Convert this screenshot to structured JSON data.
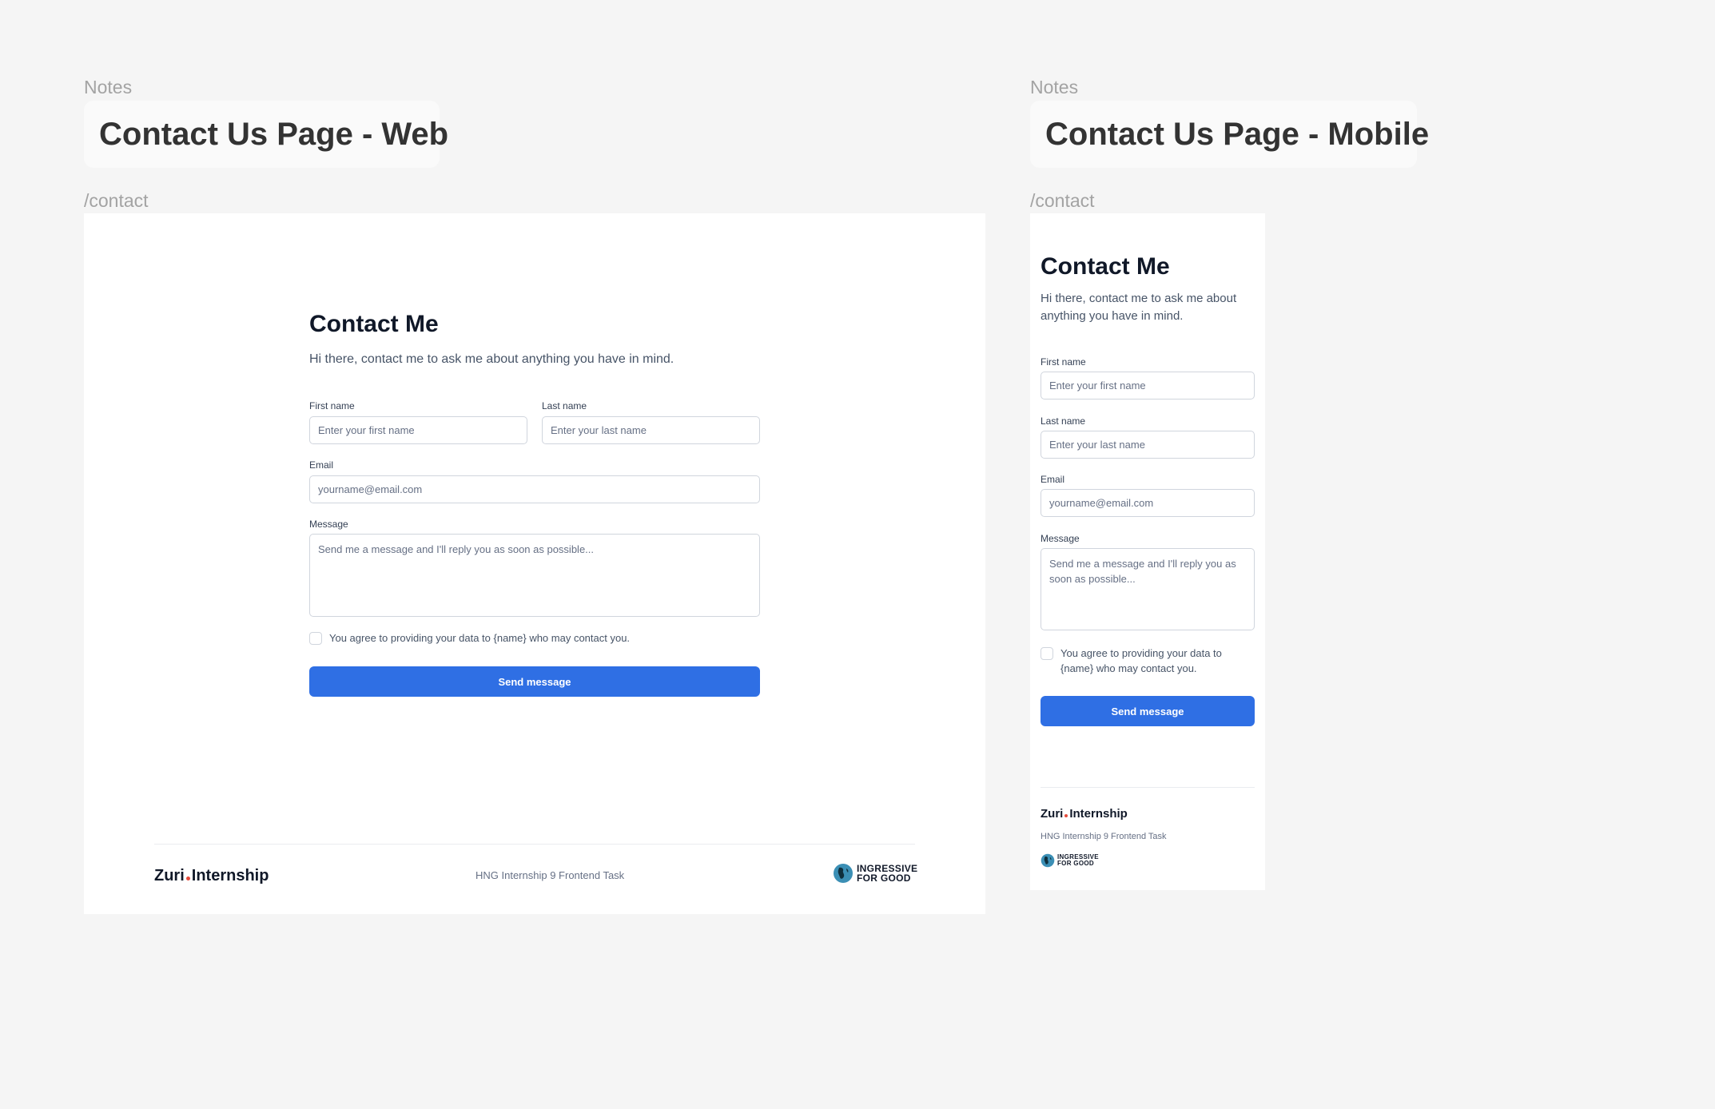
{
  "web": {
    "notes_label": "Notes",
    "notes_title": "Contact Us Page - Web",
    "route": "/contact"
  },
  "mobile": {
    "notes_label": "Notes",
    "notes_title": "Contact Us Page - Mobile",
    "route": "/contact"
  },
  "form": {
    "title": "Contact Me",
    "subtitle": "Hi there, contact me to ask me about anything you have in mind.",
    "first_name_label": "First name",
    "first_name_placeholder": "Enter your first name",
    "last_name_label": "Last name",
    "last_name_placeholder": "Enter your last name",
    "email_label": "Email",
    "email_placeholder": "yourname@email.com",
    "message_label": "Message",
    "message_placeholder": "Send me a message and I'll reply you as soon as possible...",
    "agree_text": "You agree to providing your data to {name} who may contact you.",
    "send_label": "Send message"
  },
  "footer": {
    "brand_left": "Zuri",
    "brand_right": "Internship",
    "task_text": "HNG Internship 9 Frontend Task",
    "i4g_line1": "INGRESSIVE",
    "i4g_line2": "FOR GOOD"
  },
  "colors": {
    "primary": "#2f6fe4",
    "zuri_dot": "#e54b3b",
    "canvas": "#f5f5f5"
  },
  "icons": [
    "checkbox-icon",
    "globe-icon"
  ]
}
